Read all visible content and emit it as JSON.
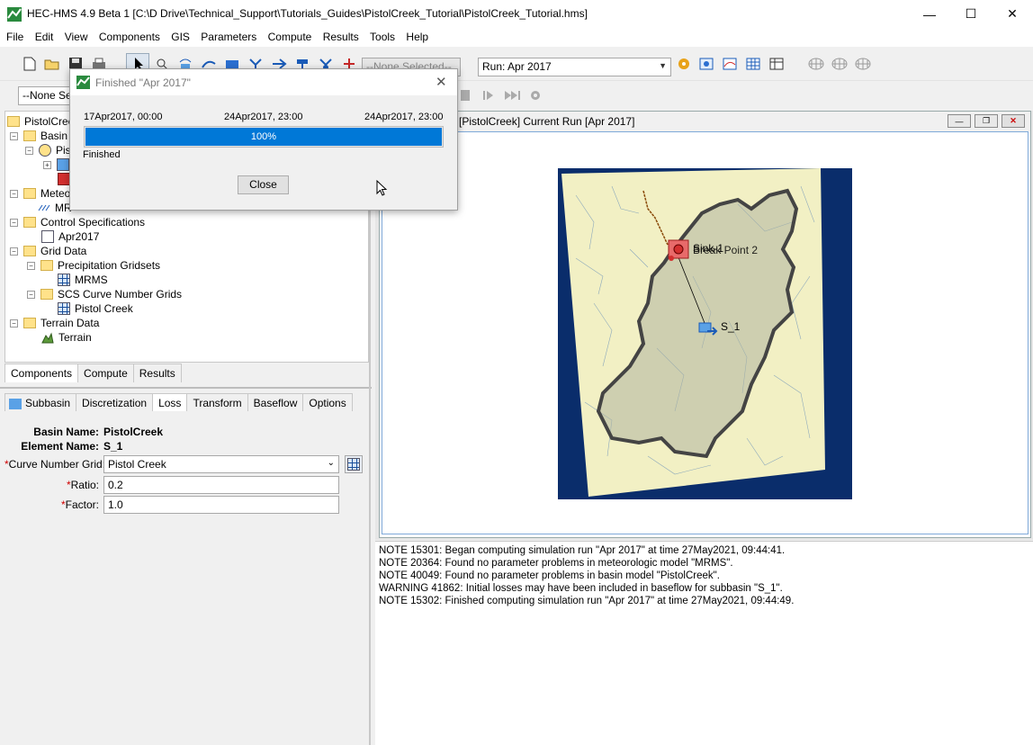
{
  "window": {
    "title": "HEC-HMS 4.9 Beta 1 [C:\\D Drive\\Technical_Support\\Tutorials_Guides\\PistolCreek_Tutorial\\PistolCreek_Tutorial.hms]"
  },
  "menu": [
    "File",
    "Edit",
    "View",
    "Components",
    "GIS",
    "Parameters",
    "Compute",
    "Results",
    "Tools",
    "Help"
  ],
  "toolbar": {
    "element_selector": "--None Selected--",
    "run_selector": "Run: Apr 2017",
    "basin_selector": "--None Sele"
  },
  "tree": {
    "root": "PistolCreek",
    "basin_models": "Basin M",
    "basin_model_item": "Pis",
    "meteorologic_models": "Meteor",
    "met_item": "MR",
    "control_specs": "Control Specifications",
    "control_item": "Apr2017",
    "grid_data": "Grid Data",
    "precip_gridsets": "Precipitation Gridsets",
    "precip_item": "MRMS",
    "scs_grids": "SCS Curve Number Grids",
    "scs_item": "Pistol Creek",
    "terrain_data": "Terrain Data",
    "terrain_item": "Terrain"
  },
  "explorer_tabs": [
    "Components",
    "Compute",
    "Results"
  ],
  "property_tabs": [
    "Subbasin",
    "Discretization",
    "Loss",
    "Transform",
    "Baseflow",
    "Options"
  ],
  "properties": {
    "basin_name_label": "Basin Name:",
    "basin_name": "PistolCreek",
    "element_name_label": "Element Name:",
    "element_name": "S_1",
    "curve_number_label": "Curve Number Grid:",
    "curve_number_value": "Pistol Creek",
    "ratio_label": "Ratio:",
    "ratio_value": "0.2",
    "factor_label": "Factor:",
    "factor_value": "1.0"
  },
  "map_window": {
    "title": "[PistolCreek] Current Run [Apr 2017]",
    "labels": {
      "sink": "Sink-1",
      "break_point": "Break Point 2",
      "subbasin": "S_1"
    },
    "colors": {
      "background": "#0a2d6b",
      "terrain": "#f2f0c4",
      "watershed_outline": "#444444"
    }
  },
  "dialog": {
    "title": "Finished \"Apr 2017\"",
    "start": "17Apr2017, 00:00",
    "current": "24Apr2017, 23:00",
    "end": "24Apr2017, 23:00",
    "progress_percent": 100,
    "progress_label": "100%",
    "status": "Finished",
    "close_button": "Close"
  },
  "log": [
    "NOTE 15301:  Began computing simulation run \"Apr 2017\" at time 27May2021, 09:44:41.",
    "NOTE 20364:  Found no parameter problems in meteorologic model \"MRMS\".",
    "NOTE 40049:  Found no parameter problems in basin model \"PistolCreek\".",
    "WARNING 41862:  Initial losses may have been included in baseflow for subbasin \"S_1\".",
    "NOTE 15302:  Finished computing simulation run \"Apr 2017\" at time 27May2021, 09:44:49."
  ]
}
